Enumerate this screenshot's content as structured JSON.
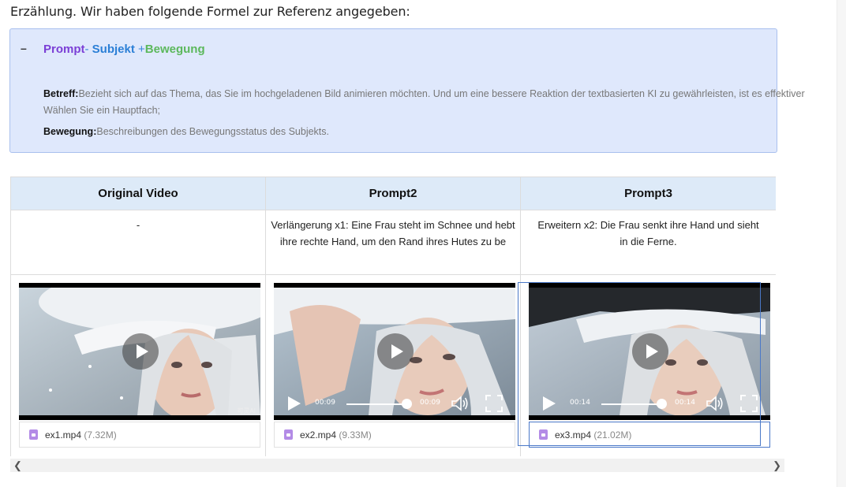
{
  "intro_text": "Erzählung. Wir haben folgende Formel zur Referenz angegeben:",
  "formula_box": {
    "toggle": "–",
    "prompt": "Prompt",
    "dash": "- ",
    "subjekt": "Subjekt",
    "plus": " +",
    "bewegung": "Bewegung",
    "definitions": [
      {
        "term": "Betreff:",
        "text": "Bezieht sich auf das Thema, das Sie im hochgeladenen Bild animieren möchten. Und um eine bessere Reaktion der textbasierten KI zu gewährleisten, ist es effektiver",
        "continuation": "Wählen Sie ein Hauptfach;"
      },
      {
        "term": "Bewegung:",
        "text": "Beschreibungen des Bewegungsstatus des Subjekts."
      }
    ]
  },
  "table": {
    "headers": [
      "Original Video",
      "Prompt2",
      "Prompt3"
    ],
    "descriptions": [
      {
        "line1": "-",
        "line2": ""
      },
      {
        "line1": "Verlängerung x1: Eine Frau steht im Schnee und hebt",
        "line2": "ihre rechte Hand, um den Rand ihres Hutes zu be"
      },
      {
        "line1": "Erweitern x2: Die Frau senkt ihre Hand und sieht",
        "line2": "in die Ferne."
      }
    ],
    "videos": [
      {
        "file_name": "ex1.mp4",
        "file_size": "(7.32M)",
        "current_time": "",
        "duration": "",
        "watermark": "可灵AI",
        "show_controls": false
      },
      {
        "file_name": "ex2.mp4",
        "file_size": "(9.33M)",
        "current_time": "00:09",
        "duration": "00:09",
        "show_controls": true
      },
      {
        "file_name": "ex3.mp4",
        "file_size": "(21.02M)",
        "current_time": "00:14",
        "duration": "00:14",
        "show_controls": true
      }
    ]
  },
  "colors": {
    "prompt": "#7b3fd6",
    "subjekt": "#2b7fd6",
    "bewegung": "#5cb85c",
    "header_bg": "#ddeaf8",
    "box_bg": "#dfe8fc",
    "selection": "#4a78c8"
  },
  "icons": {
    "play": "play-icon",
    "volume": "volume-icon",
    "fullscreen": "fullscreen-icon",
    "file": "video-file-icon",
    "scroll_left": "chevron-left-icon",
    "scroll_right": "chevron-right-icon"
  }
}
